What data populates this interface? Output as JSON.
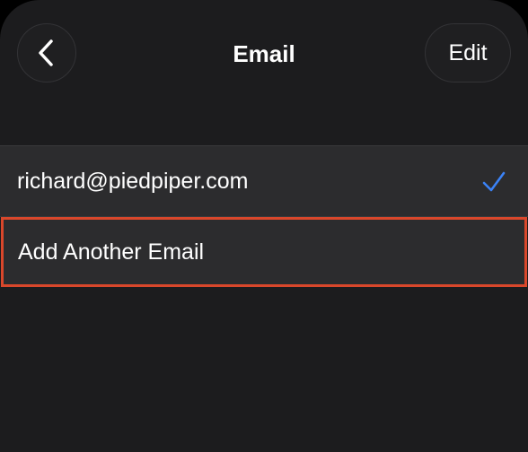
{
  "nav": {
    "title": "Email",
    "back_icon": "chevron-left-icon",
    "edit_label": "Edit"
  },
  "emails": {
    "items": [
      {
        "address": "richard@piedpiper.com",
        "selected": true,
        "check_icon": "checkmark-icon"
      }
    ],
    "add_label": "Add Another Email"
  },
  "colors": {
    "background": "#1c1c1e",
    "row_background": "#2c2c2e",
    "accent": "#3b82f6",
    "highlight": "#d9472b"
  }
}
